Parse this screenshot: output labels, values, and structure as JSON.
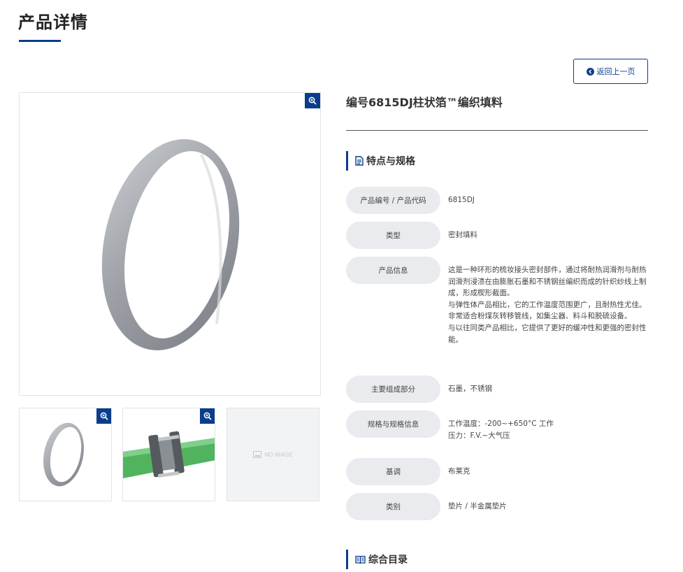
{
  "page": {
    "title": "产品详情"
  },
  "back_button": {
    "label": "返回上一页"
  },
  "product": {
    "name": "编号6815DJ柱状箔™编织填料"
  },
  "sections": {
    "specs_title": "特点与规格",
    "catalog_title": "综合目录"
  },
  "specs": [
    {
      "label": "产品编号 / 产品代码",
      "lines": [
        "6815DJ"
      ]
    },
    {
      "label": "类型",
      "lines": [
        "密封填料"
      ]
    },
    {
      "label": "产品信息",
      "lines": [
        "这是一种环形的梳妆接头密封部件，通过将耐热润滑剂与耐热润滑剂浸渍在由膨胀石墨和不锈钢丝编织而成的针织纱线上制成，形成楔形截面。",
        "与弹性体产品相比，它的工作温度范围更广，且耐热性尤佳。",
        "非常适合粉煤灰转移管线，如集尘器、料斗和脱硫设备。",
        "与以往同类产品相比，它提供了更好的缓冲性和更强的密封性能。"
      ]
    },
    {
      "label": "主要组成部分",
      "lines": [
        "石墨，不锈钢"
      ]
    },
    {
      "label": "规格与规格信息",
      "lines": [
        "工作温度：-200~+650°C 工作",
        "压力：F.V.~大气压"
      ]
    },
    {
      "label": "基调",
      "lines": [
        "布莱克"
      ]
    },
    {
      "label": "类别",
      "lines": [
        "垫片 / 半金属垫片"
      ]
    }
  ],
  "gallery": {
    "no_image_label": "NO IMAGE"
  },
  "icons": {
    "zoom": "zoom-in-icon",
    "back": "arrow-left-circle-icon",
    "document": "document-icon",
    "catalog": "book-icon",
    "image_placeholder": "image-icon"
  },
  "colors": {
    "accent": "#0a3d8c",
    "label_bg": "#e9ebee",
    "pipe_green": "#52b35f"
  }
}
